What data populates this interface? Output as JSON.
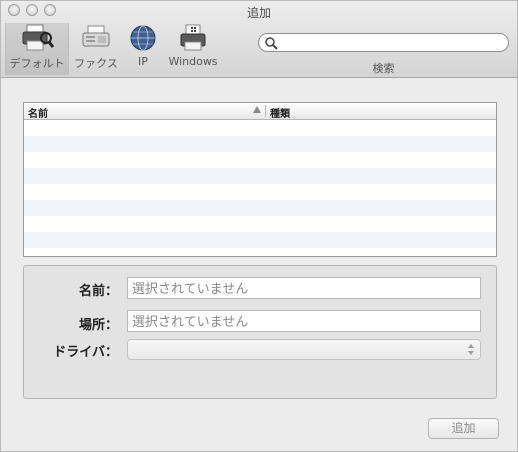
{
  "window": {
    "title": "追加"
  },
  "toolbar": {
    "items": [
      {
        "label": "デフォルト",
        "icon": "printer-search-icon",
        "selected": true
      },
      {
        "label": "ファクス",
        "icon": "fax-icon",
        "selected": false
      },
      {
        "label": "IP",
        "icon": "globe-icon",
        "selected": false
      },
      {
        "label": "Windows",
        "icon": "windows-printer-icon",
        "selected": false
      }
    ],
    "search": {
      "label": "検索",
      "placeholder": "",
      "value": ""
    }
  },
  "table": {
    "columns": [
      "名前",
      "種類"
    ],
    "sort_icon": "sort-ascending-icon",
    "rows": []
  },
  "details": {
    "name_label": "名前：",
    "name_placeholder": "選択されていません",
    "location_label": "場所：",
    "location_placeholder": "選択されていません",
    "driver_label": "ドライバ：",
    "driver_value": ""
  },
  "footer": {
    "add_button": "追加"
  },
  "colors": {
    "row_alt": "#f1f5fa",
    "panel_bg": "#e3e3e3",
    "toolbar_selected": "#c9c9c9"
  }
}
